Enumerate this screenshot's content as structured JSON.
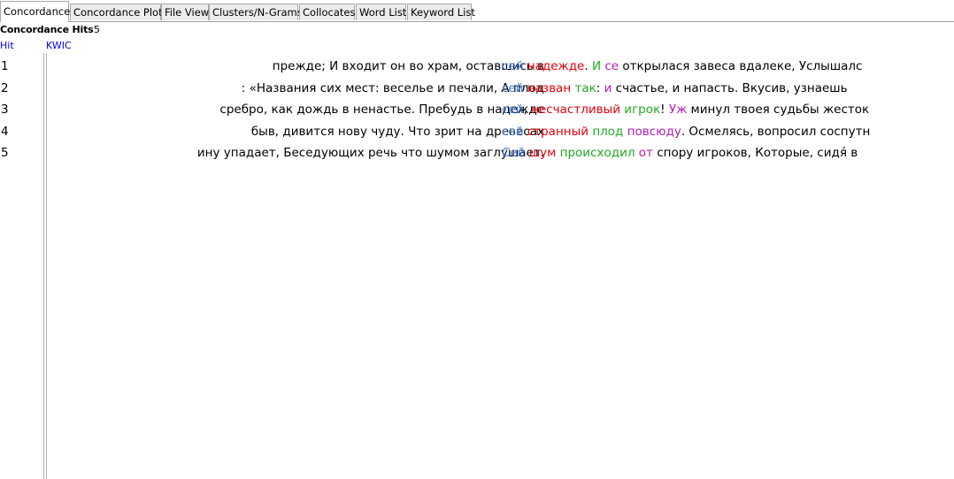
{
  "colors": {
    "blue": "#3c78d8",
    "red": "#e6000e",
    "green": "#22aa22",
    "purple": "#b020b0",
    "header_link": "#0000ee"
  },
  "tabs": [
    {
      "label": "Concordance",
      "active": true
    },
    {
      "label": "Concordance Plot",
      "active": false
    },
    {
      "label": "File View",
      "active": false
    },
    {
      "label": "Clusters/N-Grams",
      "active": false
    },
    {
      "label": "Collocates",
      "active": false
    },
    {
      "label": "Word List",
      "active": false
    },
    {
      "label": "Keyword List",
      "active": false
    }
  ],
  "summary": {
    "label": "Concordance Hits",
    "count": "5"
  },
  "columns": {
    "hit": "Hit",
    "kwic": "KWIC"
  },
  "rows": [
    {
      "hit": "1",
      "left": "прежде; И входит он во храм, оставшись в",
      "right": [
        {
          "text": "сей",
          "color": "blue"
        },
        {
          "text": " "
        },
        {
          "text": "надежде",
          "color": "red"
        },
        {
          "text": ".  "
        },
        {
          "text": "И",
          "color": "green"
        },
        {
          "text": " "
        },
        {
          "text": "се",
          "color": "purple"
        },
        {
          "text": " открылася завеса вдалеке, Услышалс"
        }
      ]
    },
    {
      "hit": "2",
      "left": ": «Названия сих мест: веселье и печали, А плод",
      "right": [
        {
          "text": "сей",
          "color": "blue"
        },
        {
          "text": " "
        },
        {
          "text": "назван",
          "color": "red"
        },
        {
          "text": " "
        },
        {
          "text": "так",
          "color": "green"
        },
        {
          "text": ": "
        },
        {
          "text": "и",
          "color": "purple"
        },
        {
          "text": " счастье, и напасть. Вкусив, узнаешь"
        }
      ]
    },
    {
      "hit": "3",
      "left": "сребро, как дождь в ненастье. Пребудь в надежде",
      "right": [
        {
          "text": "сей",
          "color": "blue"
        },
        {
          "text": ", "
        },
        {
          "text": "несчастливый",
          "color": "red"
        },
        {
          "text": " "
        },
        {
          "text": "игрок",
          "color": "green"
        },
        {
          "text": "! "
        },
        {
          "text": "Уж",
          "color": "purple"
        },
        {
          "text": " минул твоея судьбы жесток"
        }
      ]
    },
    {
      "hit": "4",
      "left": "быв, дивится нову чуду. Что зрит на древесах",
      "right": [
        {
          "text": "сей",
          "color": "blue"
        },
        {
          "text": " "
        },
        {
          "text": "странный",
          "color": "red"
        },
        {
          "text": " "
        },
        {
          "text": "плод",
          "color": "green"
        },
        {
          "text": " "
        },
        {
          "text": "повсюду",
          "color": "purple"
        },
        {
          "text": ". Осмелясь, вопросил соспутн"
        }
      ]
    },
    {
      "hit": "5",
      "left": "ину упадает, Беседующих речь что шумом заглушает.",
      "right": [
        {
          "text": "Сей",
          "color": "blue"
        },
        {
          "text": " "
        },
        {
          "text": "шум",
          "color": "red"
        },
        {
          "text": " "
        },
        {
          "text": "происходил",
          "color": "green"
        },
        {
          "text": " "
        },
        {
          "text": "от",
          "color": "purple"
        },
        {
          "text": " спору игроков, Которые, сидя́ в"
        }
      ]
    }
  ]
}
